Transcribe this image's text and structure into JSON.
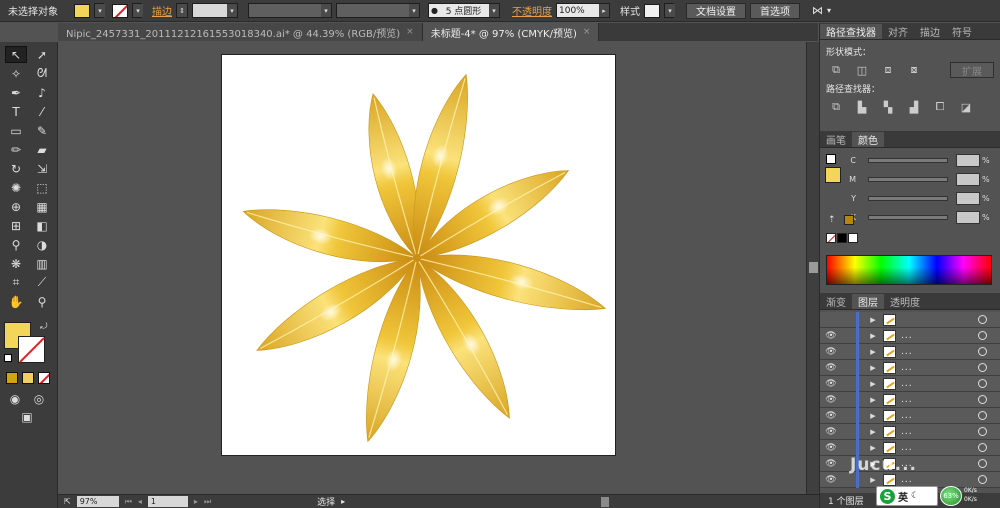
{
  "control_bar": {
    "selection_status": "未选择对象",
    "stroke_label": "描边",
    "brush_value": "5 点圆形",
    "opacity_label": "不透明度",
    "opacity_value": "100%",
    "style_label": "样式",
    "doc_settings_label": "文档设置",
    "preferences_label": "首选项",
    "colors": {
      "fill": "#f3d55a",
      "stroke_none": "#e02020"
    }
  },
  "tabs": [
    {
      "label": "Nipic_2457331_20111212161553018340.ai* @ 44.39% (RGB/预览)",
      "close": "×"
    },
    {
      "label": "未标题-4* @ 97% (CMYK/预览)",
      "close": "×"
    }
  ],
  "status_bar": {
    "zoom": "97%",
    "page": "1",
    "tool_status": "选择"
  },
  "panels": {
    "top_tabs": [
      "路径查找器",
      "对齐",
      "描边",
      "符号"
    ],
    "shape_modes_label": "形状模式：",
    "expand_label": "扩展",
    "pathfinders_label": "路径查找器：",
    "color_tabs": [
      "画笔",
      "颜色"
    ],
    "channels": [
      "C",
      "M",
      "Y",
      "K"
    ],
    "percent": "%",
    "layer_tabs": [
      "渐变",
      "图层",
      "透明度"
    ],
    "layer_names": [
      "",
      "...",
      "...",
      "...",
      "...",
      "...",
      "...",
      "...",
      "...",
      "...",
      "..."
    ],
    "layer_count": "1 个图层"
  },
  "ime": {
    "label": "英"
  },
  "net": {
    "value": "63%"
  },
  "speed": {
    "up": "0K/s",
    "down": "0K/s"
  },
  "watermark": "Jucu..."
}
